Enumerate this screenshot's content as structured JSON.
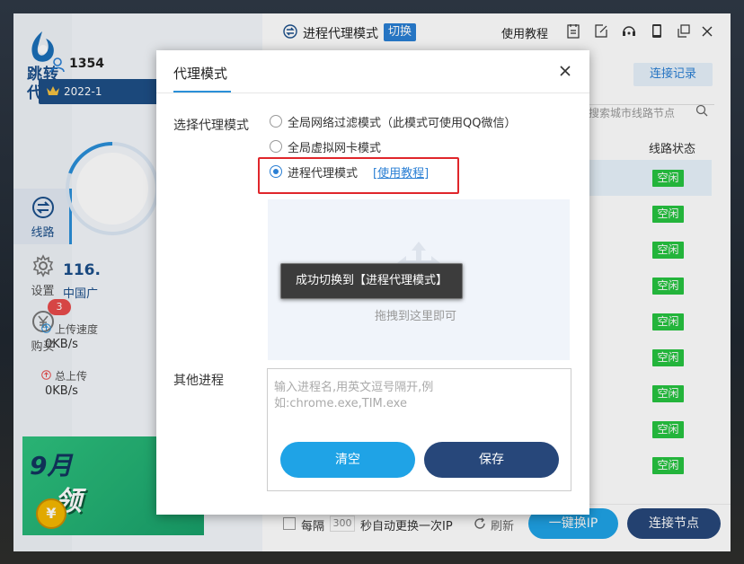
{
  "app": {
    "logo_text": "跳转代理"
  },
  "sidebar": {
    "items": [
      {
        "label": "线路",
        "icon": "switch-icon"
      },
      {
        "label": "设置",
        "icon": "gear-icon"
      },
      {
        "label": "购买",
        "icon": "yen-icon"
      }
    ],
    "buy_badge": "3"
  },
  "user": {
    "name": "1354",
    "vip_date": "2022-1",
    "ip": "116.",
    "isp": "中国广",
    "upload_speed_label": "上传速度",
    "upload_speed_value": "0KB/s",
    "total_upload_label": "总上传",
    "total_upload_value": "0KB/s"
  },
  "banner": {
    "line1": "9月",
    "line2": "领",
    "coin": "¥"
  },
  "header": {
    "mode_title": "进程代理模式",
    "switch_label": "切换",
    "tutorial_label": "使用教程"
  },
  "right_panel": {
    "connection_record": "连接记录",
    "search_placeholder": "搜索城市线路节点",
    "status_header": "线路状态",
    "statuses": [
      "空闲",
      "空闲",
      "空闲",
      "空闲",
      "空闲",
      "空闲",
      "空闲",
      "空闲",
      "空闲"
    ]
  },
  "bottom_bar": {
    "every_label": "每隔",
    "interval_value": "300",
    "suffix_label": "秒自动更换一次IP",
    "refresh_label": "刷新",
    "switch_ip_button": "一键换IP",
    "connect_button": "连接节点"
  },
  "dialog": {
    "title": "代理模式",
    "mode_label": "选择代理模式",
    "options": [
      {
        "label": "全局网络过滤模式（此模式可使用QQ微信）",
        "selected": false
      },
      {
        "label": "全局虚拟网卡模式",
        "selected": false
      },
      {
        "label": "进程代理模式",
        "selected": true
      }
    ],
    "option3_link": "[使用教程]",
    "drop_text": "拖拽到这里即可",
    "toast": "成功切换到【进程代理模式】",
    "other_label": "其他进程",
    "textarea_placeholder": "输入进程名,用英文逗号隔开,例如:chrome.exe,TIM.exe",
    "clear_button": "清空",
    "save_button": "保存"
  },
  "colors": {
    "accent": "#2a7fd4",
    "navy": "#27477a",
    "status_green": "#27c441",
    "highlight_red": "#e0262b"
  }
}
